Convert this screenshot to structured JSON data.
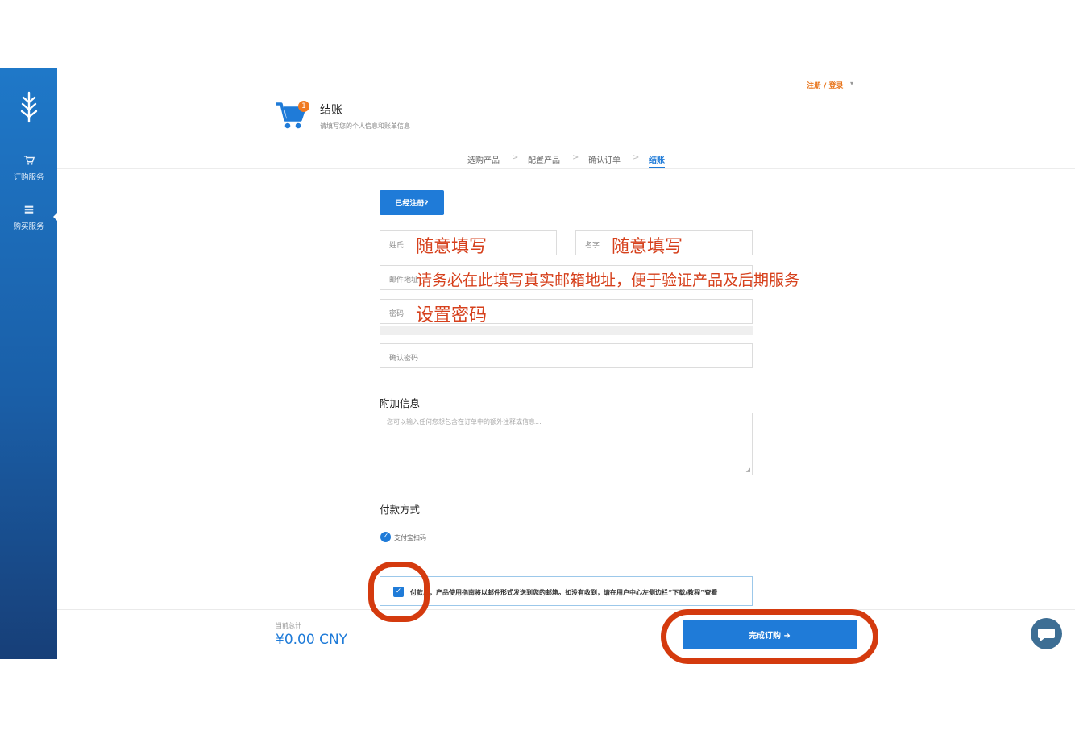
{
  "sidebar": {
    "items": [
      {
        "label": "订购服务",
        "icon": "cart-icon"
      },
      {
        "label": "购买服务",
        "icon": "list-icon"
      }
    ]
  },
  "topbar": {
    "login_label": "注册 / 登录",
    "caret": "▾"
  },
  "header": {
    "badge_count": "1",
    "title": "结账",
    "subtitle": "请填写您的个人信息和账单信息"
  },
  "steps": {
    "items": [
      "选购产品",
      "配置产品",
      "确认订单",
      "结账"
    ],
    "separator": ">",
    "active_index": 3
  },
  "form": {
    "registered_button": "已经注册?",
    "last_name_label": "姓氏",
    "last_name_value": "随意填写",
    "first_name_label": "名字",
    "first_name_value": "随意填写",
    "email_label": "邮件地址",
    "email_value": "请务必在此填写真实邮箱地址，便于验证产品及后期服务",
    "password_label": "密码",
    "password_value": "设置密码",
    "confirm_password_label": "确认密码"
  },
  "additional": {
    "title": "附加信息",
    "placeholder": "您可以输入任何您想包含在订单中的额外注释或信息..."
  },
  "payment": {
    "title": "付款方式",
    "method": "支付宝扫码"
  },
  "tos": {
    "text": "付款后，产品使用指南将以邮件形式发送到您的邮箱。如没有收到，请在用户中心左侧边栏“下载/教程”查看"
  },
  "footer": {
    "total_label": "当前总计",
    "total_value": "¥0.00 CNY",
    "complete_button": "完成订购 ➜"
  },
  "colors": {
    "primary": "#1f7bd8",
    "accent": "#e8741a",
    "annotation": "#d43a0e",
    "sidebar": "#1a5fa8"
  }
}
